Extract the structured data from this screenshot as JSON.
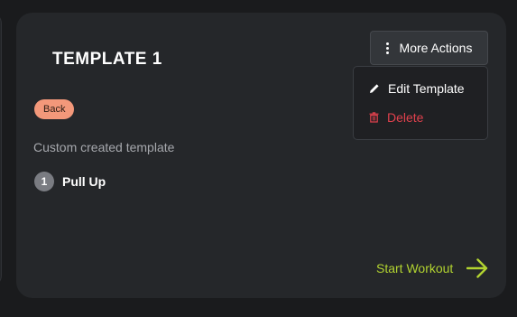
{
  "card": {
    "title": "TEMPLATE 1",
    "tag": "Back",
    "description": "Custom created template",
    "exercises": [
      {
        "number": "1",
        "name": "Pull Up"
      }
    ],
    "start_label": "Start Workout"
  },
  "actions": {
    "button_label": "More Actions",
    "menu": {
      "edit_label": "Edit Template",
      "delete_label": "Delete"
    }
  },
  "icons": {
    "more": "vertical-dots-icon",
    "edit": "pencil-icon",
    "delete": "trash-icon",
    "start": "arrow-right-icon"
  },
  "colors": {
    "background": "#1a1b1d",
    "card": "#25272a",
    "tag": "#f3987a",
    "accent": "#b2d330",
    "danger": "#e0414d"
  }
}
